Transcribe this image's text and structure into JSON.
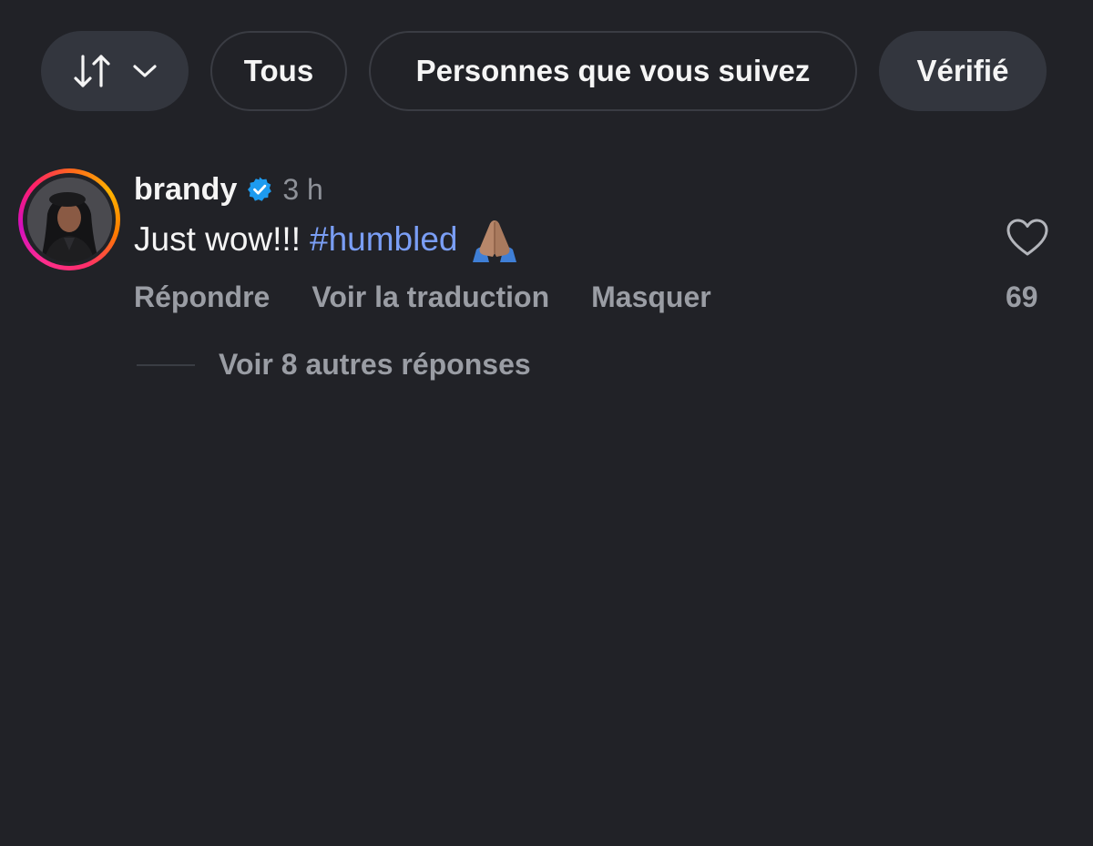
{
  "filters": {
    "sort_icon": "sort-arrows-icon",
    "dropdown_icon": "chevron-down-icon",
    "all_label": "Tous",
    "following_label": "Personnes que vous suivez",
    "verified_label": "Vérifié"
  },
  "comment": {
    "username": "brandy",
    "verified_icon": "verified-badge-icon",
    "timestamp": "3 h",
    "text": "Just wow!!!",
    "hashtag": "#humbled",
    "emoji": "folded-hands-icon",
    "like_icon": "heart-icon",
    "like_count": "69",
    "actions": {
      "reply": "Répondre",
      "translate": "Voir la traduction",
      "hide": "Masquer"
    },
    "more_replies": "Voir 8 autres réponses"
  },
  "colors": {
    "background": "#212227",
    "chip_fill": "#33363e",
    "hashtag": "#7a9ef5",
    "verified": "#1d9bf0",
    "muted_text": "#9a9da4"
  }
}
